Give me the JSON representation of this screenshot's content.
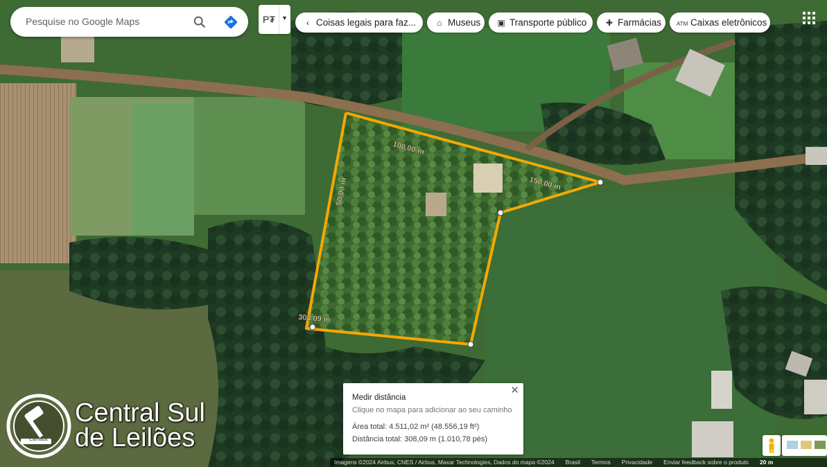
{
  "search": {
    "placeholder": "Pesquise no Google Maps"
  },
  "layer_button": {
    "label": "P₮"
  },
  "chips": [
    {
      "label": "Coisas legais para faz...",
      "icon": "chevron-left-icon"
    },
    {
      "label": "Museus",
      "icon": "museum-icon"
    },
    {
      "label": "Transporte público",
      "icon": "bus-icon"
    },
    {
      "label": "Farmácias",
      "icon": "pharmacy-icon"
    },
    {
      "label": "Caixas eletrônicos",
      "icon": "atm-icon"
    }
  ],
  "map_labels": {
    "seg1": "100,00 m",
    "seg2": "150,00 m",
    "seg3": "50,00 m",
    "total_label": "308,09 m"
  },
  "measure": {
    "title": "Medir distância",
    "hint": "Clique no mapa para adicionar ao seu caminho",
    "area": "Área total: 4.511,02 m² (48.556,19 ft²)",
    "distance": "Distância total: 308,09 m (1.010,78 pés)",
    "close": "✕"
  },
  "attribution": {
    "imagery": "Imagens ©2024 Airbus, CNES / Airbus, Maxar Technologies, Dados do mapa ©2024",
    "country": "Brasil",
    "terms": "Termos",
    "privacy": "Privacidade",
    "feedback": "Enviar feedback sobre o produto",
    "scale": "20 m"
  },
  "logo": {
    "line1": "Central Sul",
    "line2": "de Leilões",
    "small": "Camada"
  },
  "colors": {
    "measure_line": "#f5a800",
    "grass": "#3f6b34",
    "forest": "#2b4a26",
    "road": "#8c6f4f"
  }
}
